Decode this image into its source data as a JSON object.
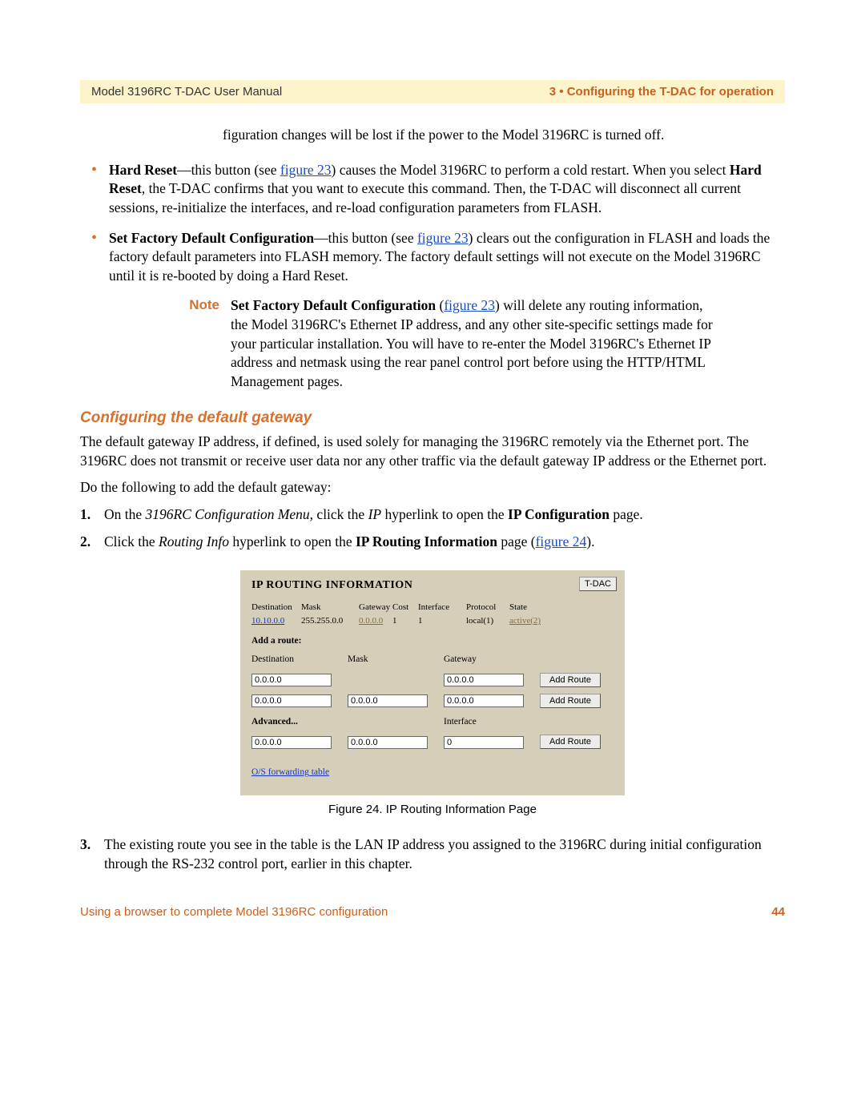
{
  "header": {
    "left": "Model 3196RC T-DAC User Manual",
    "right": "3 • Configuring the T-DAC for operation"
  },
  "intro_cont": "figuration changes will be lost if the power to the Model 3196RC is turned off.",
  "bullets": {
    "b1": {
      "lead": "Hard Reset",
      "text_a": "—this button (see ",
      "fig": "figure 23",
      "text_b": ") causes the Model 3196RC to perform a cold restart. When you select ",
      "bold2": "Hard Reset",
      "text_c": ", the T-DAC confirms that you want to execute this command. Then, the T-DAC will disconnect all current sessions, re-initialize the interfaces, and re-load configuration parameters from FLASH."
    },
    "b2": {
      "lead": "Set Factory Default Configuration",
      "text_a": "—this button (see ",
      "fig": "figure 23",
      "text_b": ") clears out the configuration in FLASH and loads the factory default parameters into FLASH memory. The factory default settings will not execute on the Model 3196RC until it is re-booted by doing a Hard Reset."
    }
  },
  "note": {
    "label": "Note",
    "bold": "Set Factory Default Configuration",
    "open": " (",
    "fig": "figure 23",
    "close": ") will delete any routing information, the Model 3196RC's Ethernet IP address, and any other site-specific settings made for your particular installation. You will have to re-enter the Model 3196RC's Ethernet IP address and netmask using the rear panel control port before using the HTTP/HTML Management pages."
  },
  "section": {
    "heading": "Configuring the default gateway",
    "p1": "The default gateway IP address, if defined, is used solely for managing the 3196RC remotely via the Ethernet port. The 3196RC does not transmit or receive user data nor any other traffic via the default gateway IP address or the Ethernet port.",
    "p2": "Do the following to add the default gateway:"
  },
  "steps": {
    "s1": {
      "num": "1.",
      "a": "On the ",
      "it1": "3196RC Configuration Menu",
      "b": ", click the ",
      "it2": "IP",
      "c": " hyperlink to open the ",
      "bold1": "IP Configuration",
      "d": " page."
    },
    "s2": {
      "num": "2.",
      "a": "Click the ",
      "it1": "Routing Info",
      "b": " hyperlink to open the ",
      "bold1": "IP Routing Information",
      "c": " page (",
      "fig": "figure 24",
      "d": ")."
    },
    "s3": {
      "num": "3.",
      "text": "The existing route you see in the table is the LAN IP address you assigned to the 3196RC during initial configuration through the RS-232 control port, earlier in this chapter."
    }
  },
  "routing": {
    "title": "IP ROUTING INFORMATION",
    "top_button": "T-DAC",
    "headers": {
      "dest": "Destination",
      "mask": "Mask",
      "gateway": "Gateway",
      "cost": "Cost",
      "iface": "Interface",
      "proto": "Protocol",
      "state": "State"
    },
    "row": {
      "dest": "10.10.0.0",
      "mask": "255.255.0.0",
      "gw": "0.0.0.0",
      "cost": "1",
      "iface": "1",
      "proto": "local(1)",
      "state": "active(2)"
    },
    "add_label": "Add a route:",
    "labels": {
      "dest": "Destination",
      "mask": "Mask",
      "gateway": "Gateway",
      "interface": "Interface",
      "advanced": "Advanced..."
    },
    "defaults": {
      "ip": "0.0.0.0",
      "zero": "0"
    },
    "add_btn": "Add Route",
    "os_link": "O/S forwarding table"
  },
  "figure_caption": "Figure 24. IP Routing Information Page",
  "footer": {
    "left": "Using a browser to complete Model 3196RC configuration",
    "right": "44"
  }
}
